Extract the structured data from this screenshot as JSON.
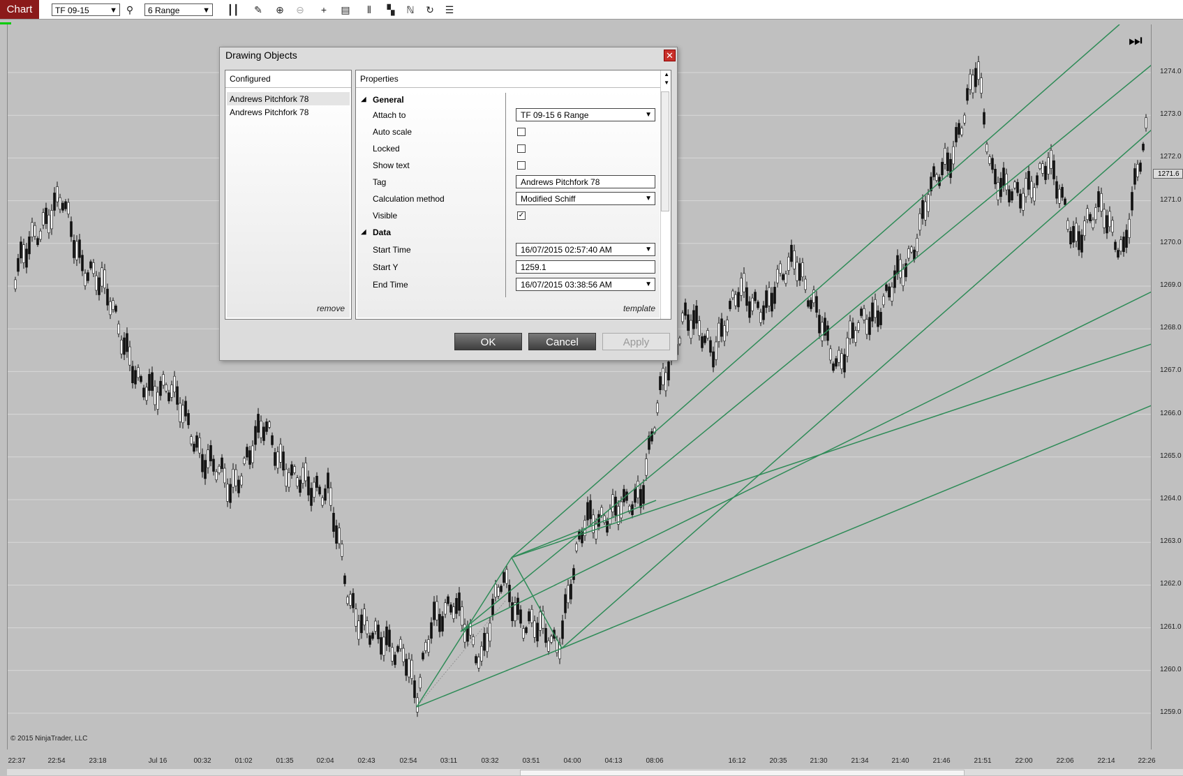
{
  "toolbar": {
    "chart_tab": "Chart",
    "instrument": "TF 09-15",
    "period": "6 Range",
    "icons": [
      "search-icon",
      "bar-style-icon",
      "pencil-icon",
      "zoom-in-icon",
      "zoom-out-icon",
      "crosshair-icon",
      "data-box-icon",
      "indicators-icon",
      "strategies-icon",
      "drawing-tools-icon",
      "reload-icon",
      "properties-icon"
    ]
  },
  "chart": {
    "copyright": "© 2015 NinjaTrader, LLC",
    "last_price": "1271.6",
    "y_ticks": [
      "1274.0",
      "1273.0",
      "1272.0",
      "1271.0",
      "1270.0",
      "1269.0",
      "1268.0",
      "1267.0",
      "1266.0",
      "1265.0",
      "1264.0",
      "1263.0",
      "1262.0",
      "1261.0",
      "1260.0",
      "1259.0"
    ],
    "x_ticks": [
      "22:37",
      "22:54",
      "23:18",
      "Jul 16",
      "00:32",
      "01:02",
      "01:35",
      "02:04",
      "02:43",
      "02:54",
      "03:11",
      "03:32",
      "03:51",
      "04:00",
      "04:13",
      "08:06",
      "16:12",
      "20:35",
      "21:30",
      "21:34",
      "21:40",
      "21:46",
      "21:51",
      "22:00",
      "22:06",
      "22:14",
      "22:26"
    ],
    "line_color": "#2e8b57",
    "background": "#c0c0c0"
  },
  "dialog": {
    "title": "Drawing Objects",
    "configured_header": "Configured",
    "configured_items": [
      "Andrews Pitchfork 78",
      "Andrews Pitchfork 78"
    ],
    "remove_label": "remove",
    "properties_header": "Properties",
    "sections": {
      "general": "General",
      "data": "Data"
    },
    "props": {
      "attach_to": {
        "label": "Attach to",
        "value": "TF 09-15 6 Range"
      },
      "auto_scale": {
        "label": "Auto scale",
        "checked": false
      },
      "locked": {
        "label": "Locked",
        "checked": false
      },
      "show_text": {
        "label": "Show text",
        "checked": false
      },
      "tag": {
        "label": "Tag",
        "value": "Andrews Pitchfork 78"
      },
      "calc_method": {
        "label": "Calculation method",
        "value": "Modified Schiff"
      },
      "visible": {
        "label": "Visible",
        "checked": true
      },
      "start_time": {
        "label": "Start Time",
        "value": "16/07/2015 02:57:40 AM"
      },
      "start_y": {
        "label": "Start Y",
        "value": "1259.1"
      },
      "end_time": {
        "label": "End Time",
        "value": "16/07/2015 03:38:56 AM"
      }
    },
    "template_label": "template",
    "ok_label": "OK",
    "cancel_label": "Cancel",
    "apply_label": "Apply"
  }
}
